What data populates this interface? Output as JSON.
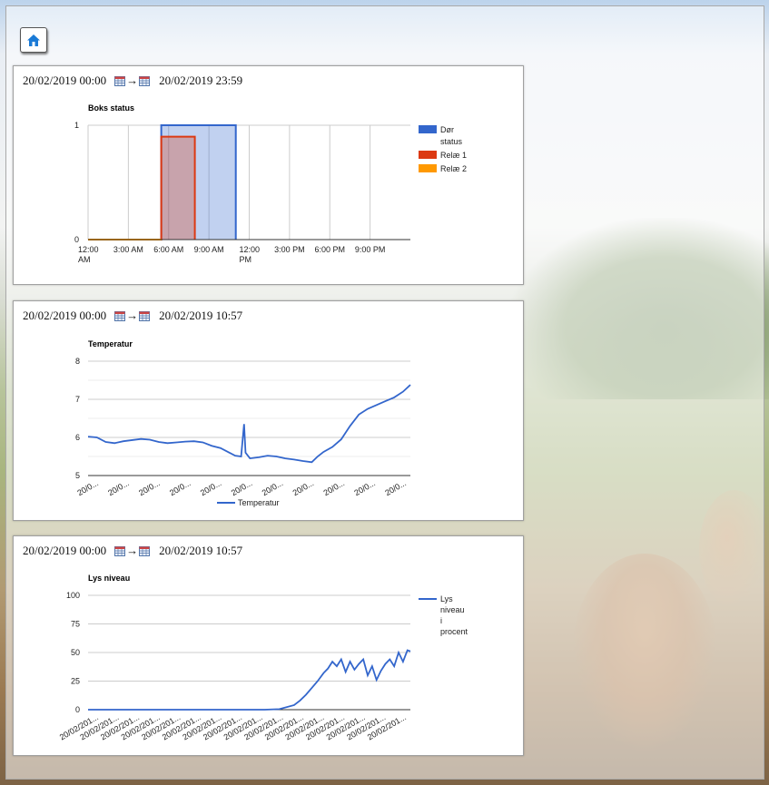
{
  "colors": {
    "dor": "#3366cc",
    "rele1": "#dc3912",
    "rele2": "#ff9900",
    "line": "#3366cc"
  },
  "home": {
    "icon": "home-icon"
  },
  "panels": [
    {
      "from": "20/02/2019 00:00",
      "arrow": "→",
      "to": "20/02/2019 23:59",
      "chart_data": {
        "type": "area",
        "title": "Boks status",
        "x_ticks": [
          [
            "12:00",
            "AM"
          ],
          [
            "3:00 AM"
          ],
          [
            "6:00 AM"
          ],
          [
            "9:00 AM"
          ],
          [
            "12:00",
            "PM"
          ],
          [
            "3:00 PM"
          ],
          [
            "6:00 PM"
          ],
          [
            "9:00 PM"
          ]
        ],
        "x_tick_hours": [
          0,
          3,
          6,
          9,
          12,
          15,
          18,
          21
        ],
        "xlim_hours": [
          0,
          24
        ],
        "y_ticks": [
          "0",
          "1"
        ],
        "ylim": [
          0,
          1
        ],
        "series": [
          {
            "name": "Dør",
            "name2": "status",
            "color": "#3366cc",
            "points": [
              [
                0,
                0
              ],
              [
                5.45,
                0
              ],
              [
                5.45,
                1
              ],
              [
                11,
                1
              ],
              [
                11,
                0
              ]
            ]
          },
          {
            "name": "Relæ 1",
            "color": "#dc3912",
            "points": [
              [
                0,
                0
              ],
              [
                5.45,
                0
              ],
              [
                5.45,
                0.9
              ],
              [
                7.95,
                0.9
              ],
              [
                7.95,
                0
              ]
            ]
          },
          {
            "name": "Relæ 2",
            "color": "#ff9900",
            "points": [
              [
                0,
                0
              ],
              [
                5.45,
                0
              ]
            ]
          }
        ],
        "legend": "right"
      }
    },
    {
      "from": "20/02/2019 00:00",
      "arrow": "→",
      "to": "20/02/2019 10:57",
      "chart_data": {
        "type": "line",
        "title": "Temperatur",
        "y_ticks": [
          "5",
          "6",
          "7",
          "8"
        ],
        "ylim": [
          5,
          8
        ],
        "x_tick_label": "20/0...",
        "x_tick_count": 11,
        "xlim_hours": [
          0,
          10.95
        ],
        "x": [
          0,
          0.3,
          0.6,
          0.9,
          1.2,
          1.5,
          1.8,
          2.1,
          2.4,
          2.7,
          3.0,
          3.3,
          3.6,
          3.9,
          4.2,
          4.5,
          4.8,
          5.0,
          5.2,
          5.3,
          5.35,
          5.5,
          5.8,
          6.1,
          6.4,
          6.7,
          7.0,
          7.3,
          7.6,
          7.8,
          8.0,
          8.3,
          8.6,
          8.9,
          9.2,
          9.5,
          9.8,
          10.1,
          10.4,
          10.7,
          10.95
        ],
        "y": [
          6.02,
          6.0,
          5.88,
          5.85,
          5.9,
          5.93,
          5.96,
          5.94,
          5.88,
          5.85,
          5.87,
          5.89,
          5.9,
          5.87,
          5.78,
          5.72,
          5.6,
          5.52,
          5.5,
          6.35,
          5.6,
          5.45,
          5.48,
          5.52,
          5.5,
          5.45,
          5.42,
          5.38,
          5.35,
          5.5,
          5.62,
          5.75,
          5.95,
          6.3,
          6.6,
          6.75,
          6.85,
          6.95,
          7.05,
          7.2,
          7.38
        ],
        "series": [
          {
            "name": "Temperatur",
            "color": "#3366cc"
          }
        ],
        "legend": "bottom"
      }
    },
    {
      "from": "20/02/2019 00:00",
      "arrow": "→",
      "to": "20/02/2019 10:57",
      "chart_data": {
        "type": "line",
        "title": "Lys niveau",
        "y_ticks": [
          "0",
          "25",
          "50",
          "75",
          "100"
        ],
        "ylim": [
          0,
          100
        ],
        "x_tick_label": "20/02/201...",
        "x_tick_count": 16,
        "xlim_hours": [
          0,
          10.95
        ],
        "x": [
          0,
          1,
          2,
          3,
          4,
          5,
          6,
          6.5,
          7.0,
          7.2,
          7.4,
          7.6,
          7.8,
          8.0,
          8.15,
          8.3,
          8.45,
          8.6,
          8.75,
          8.9,
          9.05,
          9.2,
          9.35,
          9.5,
          9.65,
          9.8,
          9.95,
          10.1,
          10.25,
          10.4,
          10.55,
          10.7,
          10.85,
          10.95
        ],
        "y": [
          0,
          0,
          0,
          0,
          0,
          0,
          0,
          0.5,
          4,
          8,
          13,
          19,
          25,
          32,
          36,
          42,
          38,
          44,
          33,
          42,
          35,
          40,
          44,
          30,
          38,
          26,
          34,
          40,
          44,
          38,
          50,
          42,
          52,
          51
        ],
        "series": [
          {
            "name": "Lys",
            "name2": "niveau",
            "name3": "i",
            "name4": "procent",
            "color": "#3366cc"
          }
        ],
        "legend": "right"
      }
    }
  ]
}
